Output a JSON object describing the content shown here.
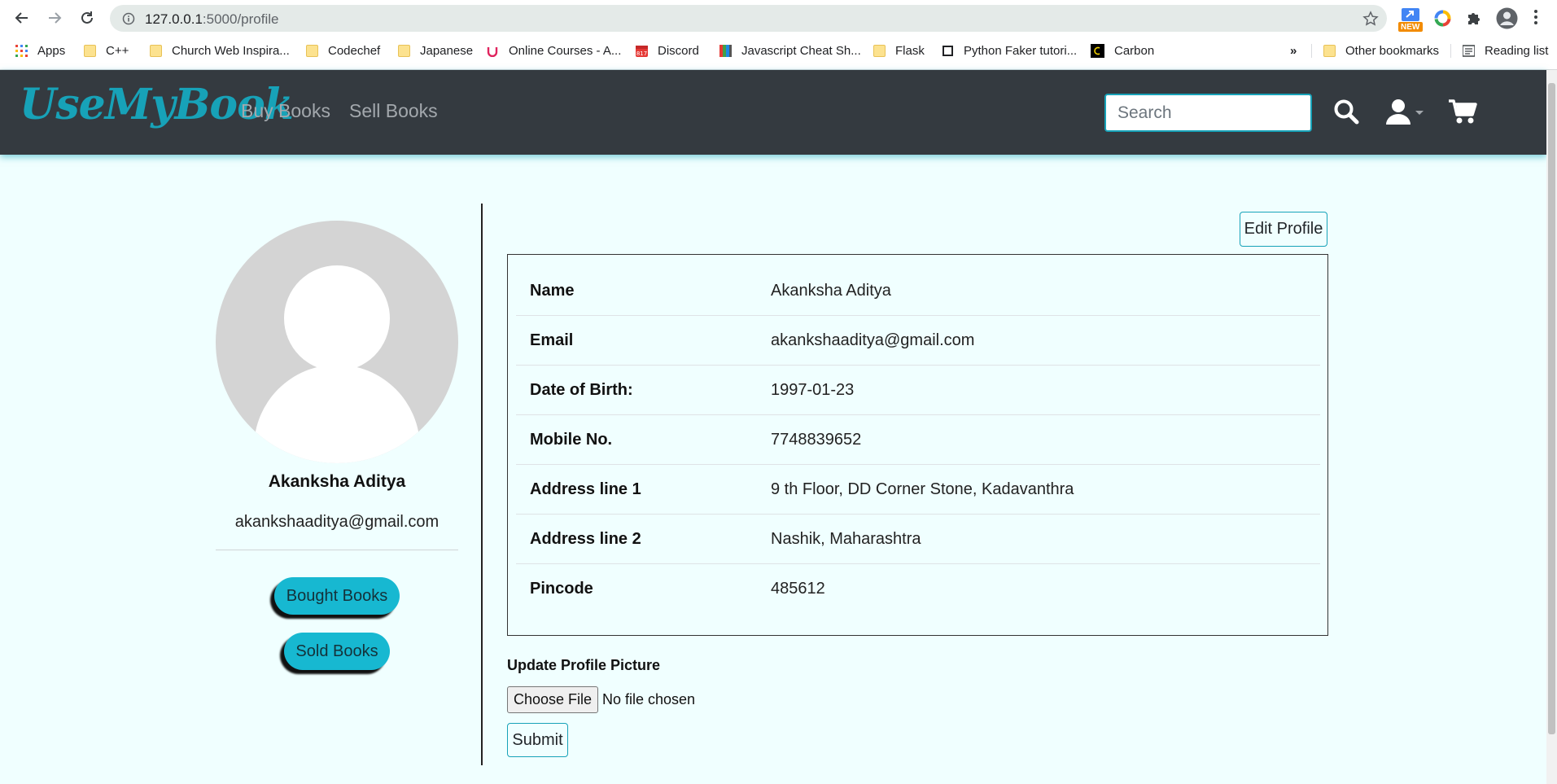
{
  "browser": {
    "url_host": "127.0.0.1",
    "url_path": ":5000/profile",
    "bookmarks": [
      {
        "label": "Apps",
        "icon": "apps-grid-icon"
      },
      {
        "label": "C++",
        "icon": "folder-icon"
      },
      {
        "label": "Church Web Inspira...",
        "icon": "folder-icon"
      },
      {
        "label": "Codechef",
        "icon": "folder-icon"
      },
      {
        "label": "Japanese",
        "icon": "folder-icon"
      },
      {
        "label": "Online Courses - A...",
        "icon": "udemy-icon"
      },
      {
        "label": "Discord",
        "icon": "calendar-icon"
      },
      {
        "label": "Javascript Cheat Sh...",
        "icon": "book-icon"
      },
      {
        "label": "Flask",
        "icon": "folder-icon"
      },
      {
        "label": "Python Faker tutori...",
        "icon": "page-icon"
      },
      {
        "label": "Carbon",
        "icon": "carbon-icon"
      }
    ],
    "overflow_label": "»",
    "other_bookmarks": "Other bookmarks",
    "reading_list": "Reading list",
    "ext_new_badge": "NEW"
  },
  "navbar": {
    "brand": "UseMyBook",
    "links": [
      "Buy Books",
      "Sell Books"
    ],
    "search_placeholder": "Search"
  },
  "profile": {
    "name": "Akanksha Aditya",
    "email": "akankshaaditya@gmail.com",
    "bought_books_label": "Bought Books",
    "sold_books_label": "Sold Books",
    "edit_label": "Edit Profile",
    "rows": [
      {
        "key": "Name",
        "value": "Akanksha Aditya"
      },
      {
        "key": "Email",
        "value": "akankshaaditya@gmail.com"
      },
      {
        "key": "Date of Birth:",
        "value": "1997-01-23"
      },
      {
        "key": "Mobile No.",
        "value": "7748839652"
      },
      {
        "key": "Address line 1",
        "value": "9 th Floor, DD Corner Stone, Kadavanthra"
      },
      {
        "key": "Address line 2",
        "value": "Nashik, Maharashtra"
      },
      {
        "key": "Pincode",
        "value": "485612"
      }
    ],
    "update_picture_label": "Update Profile Picture",
    "choose_file_label": "Choose File",
    "no_file_label": "No file chosen",
    "submit_label": "Submit"
  },
  "colors": {
    "accent": "#17a2b8",
    "navbar_bg": "#343a40",
    "page_bg": "#f0ffff"
  }
}
